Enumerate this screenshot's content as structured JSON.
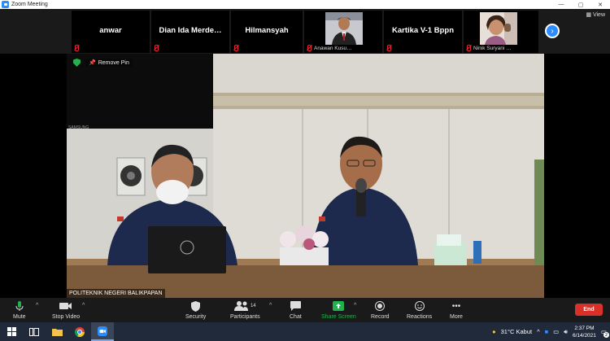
{
  "window": {
    "title": "Zoom Meeting",
    "controls": [
      "—",
      "▢",
      "✕"
    ]
  },
  "gallery": {
    "participants": [
      {
        "name": "anwar",
        "footer_name": "",
        "has_video": false
      },
      {
        "name": "Dian Ida Merde…",
        "footer_name": "",
        "has_video": false
      },
      {
        "name": "Hilmansyah",
        "footer_name": "",
        "has_video": false
      },
      {
        "name": "",
        "footer_name": "Anawan Kusu…",
        "has_video": true
      },
      {
        "name": "Kartika V-1 Bppn",
        "footer_name": "",
        "has_video": false
      },
      {
        "name": "",
        "footer_name": "Ninik Suryani …",
        "has_video": true
      }
    ],
    "next_label": "›",
    "view_label": "View"
  },
  "main_video": {
    "remove_pin_label": "Remove Pin",
    "speaker_name": "POLITEKNIK NEGERI BALIKPAPAN",
    "tv_brand": "SAMSUNG"
  },
  "toolbar": {
    "mute": "Mute",
    "stop_video": "Stop Video",
    "security": "Security",
    "participants": "Participants",
    "participants_count": "14",
    "chat": "Chat",
    "share_screen": "Share Screen",
    "record": "Record",
    "reactions": "Reactions",
    "more": "More",
    "end": "End"
  },
  "taskbar": {
    "weather": "31°C  Kabut",
    "time": "2:37 PM",
    "date": "6/14/2021",
    "notification_count": "2"
  },
  "colors": {
    "accent": "#2d8cff",
    "end": "#d9302a",
    "share": "#23b14d",
    "muted": "#e22233"
  }
}
